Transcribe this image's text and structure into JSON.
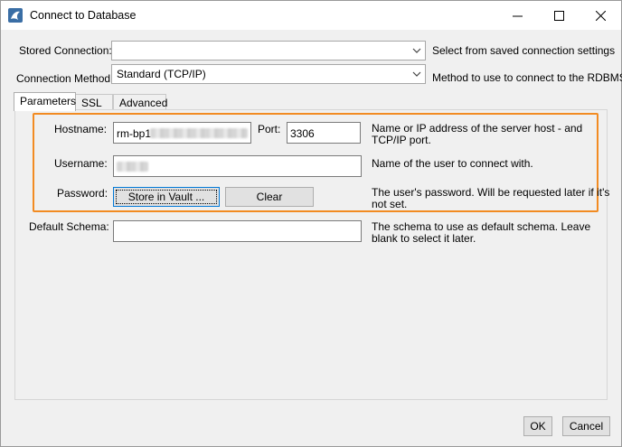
{
  "window": {
    "title": "Connect to Database",
    "icon": "mysql-workbench-dolphin-icon"
  },
  "stored_connection": {
    "label": "Stored Connection:",
    "value": "",
    "description": "Select from saved connection settings"
  },
  "connection_method": {
    "label": "Connection Method:",
    "value": "Standard (TCP/IP)",
    "description": "Method to use to connect to the RDBMS"
  },
  "tabs": [
    {
      "label": "Parameters",
      "active": true
    },
    {
      "label": "SSL",
      "active": false
    },
    {
      "label": "Advanced",
      "active": false
    }
  ],
  "hostname": {
    "label": "Hostname:",
    "value": "rm-bp1",
    "description_line1": "Name or IP address of the server host - and",
    "description_line2": "TCP/IP port."
  },
  "port": {
    "label": "Port:",
    "value": "3306"
  },
  "username": {
    "label": "Username:",
    "value": "",
    "description": "Name of the user to connect with."
  },
  "password": {
    "label": "Password:",
    "store_button": "Store in Vault ...",
    "clear_button": "Clear",
    "description_line1": "The user's password. Will be requested later if it's",
    "description_line2": "not set."
  },
  "default_schema": {
    "label": "Default Schema:",
    "value": "",
    "description_line1": "The schema to use as default schema. Leave",
    "description_line2": "blank to select it later."
  },
  "footer": {
    "ok_label": "OK",
    "cancel_label": "Cancel"
  },
  "colors": {
    "highlight_border": "#f28b22",
    "focus_border": "#0078d7"
  }
}
